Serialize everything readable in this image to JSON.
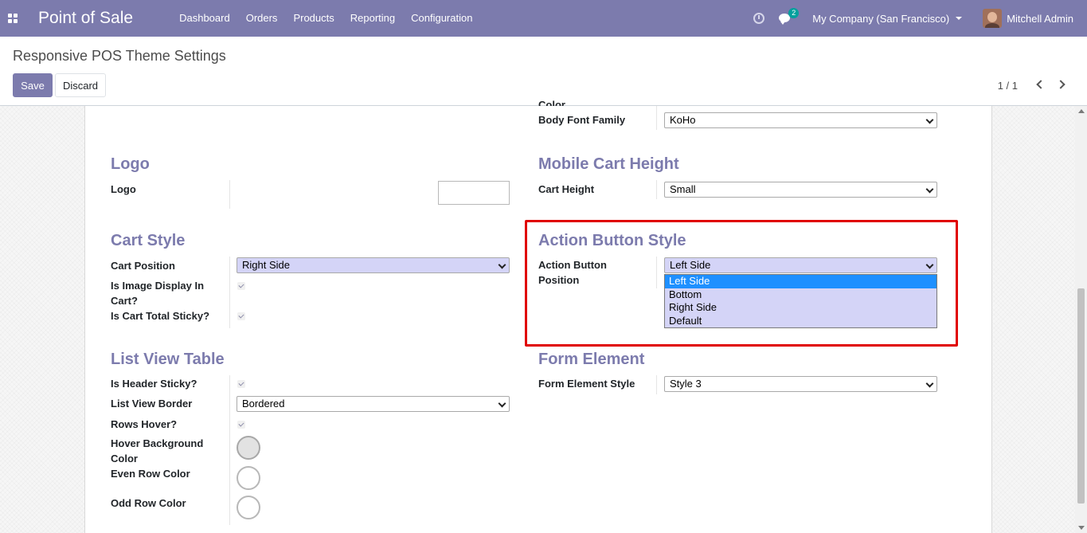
{
  "navbar": {
    "app_title": "Point of Sale",
    "menu": [
      "Dashboard",
      "Orders",
      "Products",
      "Reporting",
      "Configuration"
    ],
    "chat_count": "2",
    "company": "My Company (San Francisco)",
    "user": "Mitchell Admin"
  },
  "control_panel": {
    "breadcrumb": "Responsive POS Theme Settings",
    "save_label": "Save",
    "discard_label": "Discard",
    "pager": "1 / 1"
  },
  "form": {
    "truncated_label": "Color",
    "body_font_family": {
      "label": "Body Font Family",
      "value": "KoHo"
    },
    "logo": {
      "title": "Logo",
      "label": "Logo"
    },
    "mobile_cart_height": {
      "title": "Mobile Cart Height",
      "label": "Cart Height",
      "value": "Small"
    },
    "cart_style": {
      "title": "Cart Style",
      "cart_position_label": "Cart Position",
      "cart_position_value": "Right Side",
      "image_display_label_1": "Is Image Display In",
      "image_display_label_2": "Cart?",
      "image_display_checked": true,
      "total_sticky_label": "Is Cart Total Sticky?",
      "total_sticky_checked": true
    },
    "action_button_style": {
      "title": "Action Button Style",
      "label_1": "Action Button",
      "label_2": "Position",
      "value": "Left Side",
      "options": [
        "Left Side",
        "Bottom",
        "Right Side",
        "Default"
      ],
      "selected_option": "Left Side"
    },
    "list_view_table": {
      "title": "List View Table",
      "header_sticky_label": "Is Header Sticky?",
      "header_sticky_checked": true,
      "border_label": "List View Border",
      "border_value": "Bordered",
      "rows_hover_label": "Rows Hover?",
      "rows_hover_checked": true,
      "hover_bg_label_1": "Hover Background",
      "hover_bg_label_2": "Color",
      "even_row_label": "Even Row Color",
      "odd_row_label": "Odd Row Color"
    },
    "form_element": {
      "title": "Form Element",
      "label": "Form Element Style",
      "value": "Style 3"
    }
  },
  "colors": {
    "brand": "#7c7bad",
    "highlight": "#e00000",
    "select_bg": "#d4d4f7",
    "dropdown_selected": "#1e90ff"
  }
}
